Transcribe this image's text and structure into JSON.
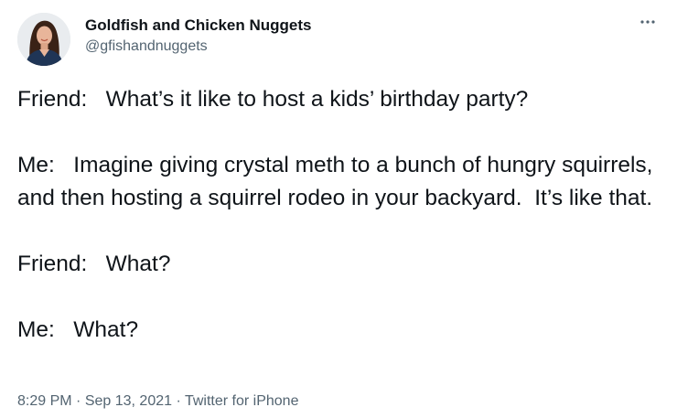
{
  "author": {
    "display_name": "Goldfish and Chicken Nuggets",
    "handle": "@gfishandnuggets",
    "avatar_icon": "profile-photo"
  },
  "more_icon": "more-horizontal-icon",
  "tweet": {
    "paragraphs": [
      "Friend:   What’s it like to host a kids’ birthday party?",
      "Me:   Imagine giving crystal meth to a bunch of hungry squirrels, and then hosting a squirrel rodeo in your backyard.  It’s like that.",
      "Friend:   What?",
      "Me:   What?"
    ]
  },
  "meta": {
    "time": "8:29 PM",
    "separator": "·",
    "date": "Sep 13, 2021",
    "source": "Twitter for iPhone"
  },
  "colors": {
    "text": "#0f1419",
    "secondary": "#536471",
    "background": "#ffffff"
  }
}
